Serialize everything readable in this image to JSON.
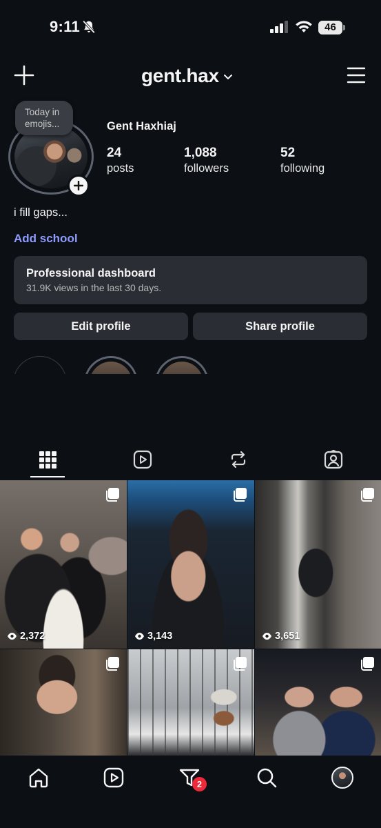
{
  "status_bar": {
    "time": "9:11",
    "battery": "46"
  },
  "header": {
    "username": "gent.hax"
  },
  "profile": {
    "note": "Today in emojis...",
    "full_name": "Gent Haxhiaj",
    "stats": [
      {
        "value": "24",
        "label": "posts"
      },
      {
        "value": "1,088",
        "label": "followers"
      },
      {
        "value": "52",
        "label": "following"
      }
    ],
    "bio": "i fill gaps...",
    "add_school": "Add school"
  },
  "dashboard": {
    "title": "Professional dashboard",
    "subtitle": "31.9K views in the last 30 days."
  },
  "buttons": {
    "edit": "Edit profile",
    "share": "Share profile"
  },
  "tabs": [
    {
      "icon": "grid-icon",
      "active": true
    },
    {
      "icon": "reels-icon",
      "active": false
    },
    {
      "icon": "reposts-icon",
      "active": false
    },
    {
      "icon": "tagged-icon",
      "active": false
    }
  ],
  "posts": [
    {
      "views": "2,372",
      "multi": true
    },
    {
      "views": "3,143",
      "multi": true
    },
    {
      "views": "3,651",
      "multi": true
    },
    {
      "views": "",
      "multi": true
    },
    {
      "views": "",
      "multi": true
    },
    {
      "views": "",
      "multi": true
    }
  ],
  "bottom_nav": {
    "activity_badge": "2"
  },
  "colors": {
    "background": "#0c0f14",
    "accent_link": "#8f9cff",
    "badge": "#ee2a3a",
    "card": "#2a2d33"
  }
}
